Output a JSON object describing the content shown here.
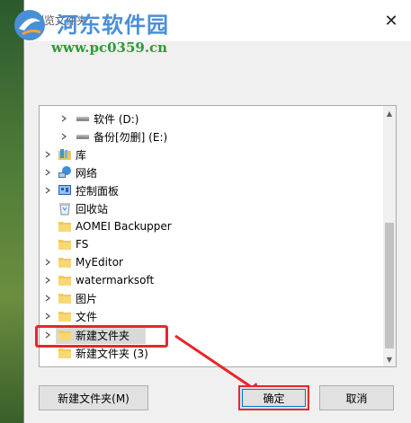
{
  "dialog": {
    "title": "浏览文件夹",
    "close_label": "✕"
  },
  "watermark": {
    "title": "河东软件园",
    "url": "www.pc0359.cn"
  },
  "tree": {
    "items": [
      {
        "label": "软件 (D:)",
        "icon": "drive-icon"
      },
      {
        "label": "备份[勿删] (E:)",
        "icon": "drive-icon"
      },
      {
        "label": "库",
        "icon": "library-icon"
      },
      {
        "label": "网络",
        "icon": "network-icon"
      },
      {
        "label": "控制面板",
        "icon": "control-panel-icon"
      },
      {
        "label": "回收站",
        "icon": "recycle-bin-icon"
      },
      {
        "label": "AOMEI Backupper",
        "icon": "folder-icon"
      },
      {
        "label": "FS",
        "icon": "folder-icon"
      },
      {
        "label": "MyEditor",
        "icon": "folder-icon"
      },
      {
        "label": "watermarksoft",
        "icon": "folder-icon"
      },
      {
        "label": "图片",
        "icon": "folder-icon"
      },
      {
        "label": "文件",
        "icon": "folder-icon"
      },
      {
        "label": "新建文件夹",
        "icon": "folder-icon"
      },
      {
        "label": "新建文件夹 (3)",
        "icon": "folder-icon"
      }
    ]
  },
  "buttons": {
    "new_folder": "新建文件夹(M)",
    "ok": "确定",
    "cancel": "取消"
  },
  "colors": {
    "accent": "#0078d7",
    "annotation": "#e8262c",
    "folder": "#f4c95a"
  }
}
